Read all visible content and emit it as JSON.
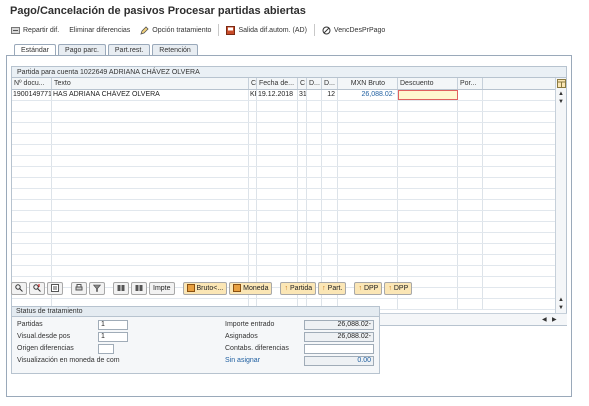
{
  "title": "Pago/Cancelación de pasivos Procesar partidas abiertas",
  "toolbar": {
    "repartir": "Repartir dif.",
    "eliminar": "Eliminar diferencias",
    "opcion": "Opción tratamiento",
    "salida": "Salida dif.autom. (AD)",
    "venc": "VencDesPrPago"
  },
  "tabs": [
    "Estándar",
    "Pago parc.",
    "Part.rest.",
    "Retención"
  ],
  "grid": {
    "title": "Partida para cuenta 1022649 ADRIANA CHÁVEZ OLVERA",
    "headers": [
      "Nº docu...",
      "Texto",
      "C",
      "Fecha de...",
      "C",
      "D...",
      "D...",
      "MXN Bruto",
      "Descuento",
      "Por..."
    ],
    "row": {
      "doc": "1900149771",
      "text": "HAS ADRIANA CHÁVEZ OLVERA",
      "c1": "KR",
      "date": "19.12.2018",
      "c2": "31",
      "d1": "",
      "d2": "12",
      "gross": "26,088.02-",
      "discount": "",
      "pct": ""
    }
  },
  "buttons": {
    "impte": "Impte",
    "bruto": "Bruto<...",
    "moneda": "Moneda",
    "partida": "Partida",
    "part": "Part.",
    "dpp1": "DPP",
    "dpp2": "DPP"
  },
  "status": {
    "title": "Status de tratamiento",
    "partidas_label": "Partidas",
    "partidas_value": "1",
    "visual_label": "Visual.desde pos",
    "visual_value": "1",
    "origen_label": "Origen diferencias",
    "moneda_label": "Visualización en moneda de com",
    "importe_label": "Importe entrado",
    "importe_value": "26,088.02-",
    "asignados_label": "Asignados",
    "asignados_value": "26,088.02-",
    "contabs_label": "Contabs. diferencias",
    "sinasignar_label": "Sin asignar",
    "sinasignar_value": "0.00"
  },
  "colors": {
    "link": "#1f5fa0",
    "button_bg": "#fbe6b5",
    "highlight_border": "#e06060"
  }
}
